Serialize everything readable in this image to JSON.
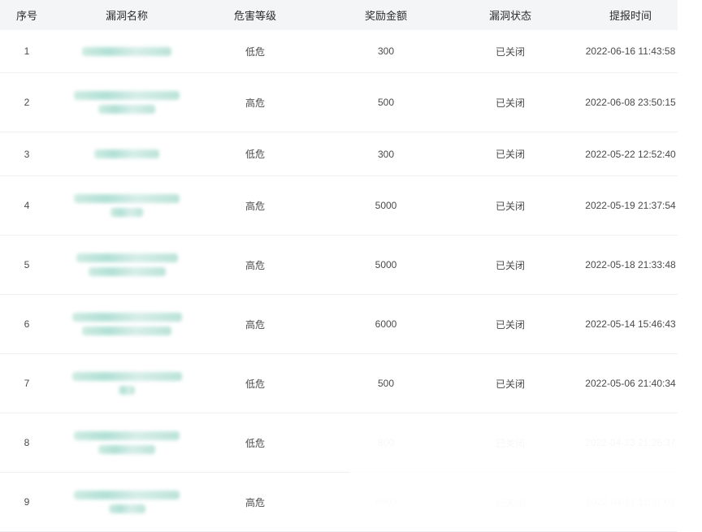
{
  "table": {
    "headers": [
      "序号",
      "漏洞名称",
      "危害等级",
      "奖励金额",
      "漏洞状态",
      "提报时间"
    ],
    "rows": [
      {
        "index": "1",
        "name": "",
        "level": "低危",
        "reward": "300",
        "status": "已关闭",
        "time": "2022-06-16 11:43:58"
      },
      {
        "index": "2",
        "name": "",
        "level": "高危",
        "reward": "500",
        "status": "已关闭",
        "time": "2022-06-08 23:50:15"
      },
      {
        "index": "3",
        "name": "",
        "level": "低危",
        "reward": "300",
        "status": "已关闭",
        "time": "2022-05-22 12:52:40"
      },
      {
        "index": "4",
        "name": "",
        "level": "高危",
        "reward": "5000",
        "status": "已关闭",
        "time": "2022-05-19 21:37:54"
      },
      {
        "index": "5",
        "name": "",
        "level": "高危",
        "reward": "5000",
        "status": "已关闭",
        "time": "2022-05-18 21:33:48"
      },
      {
        "index": "6",
        "name": "",
        "level": "高危",
        "reward": "6000",
        "status": "已关闭",
        "time": "2022-05-14 15:46:43"
      },
      {
        "index": "7",
        "name": "",
        "level": "低危",
        "reward": "500",
        "status": "已关闭",
        "time": "2022-05-06 21:40:34"
      },
      {
        "index": "8",
        "name": "",
        "level": "低危",
        "reward": "800",
        "status": "已关闭",
        "time": "2022-04-23 21:25:37"
      },
      {
        "index": "9",
        "name": "",
        "level": "高危",
        "reward": "6000",
        "status": "已关闭",
        "time": "2022-04-27 11:31:03"
      }
    ]
  }
}
